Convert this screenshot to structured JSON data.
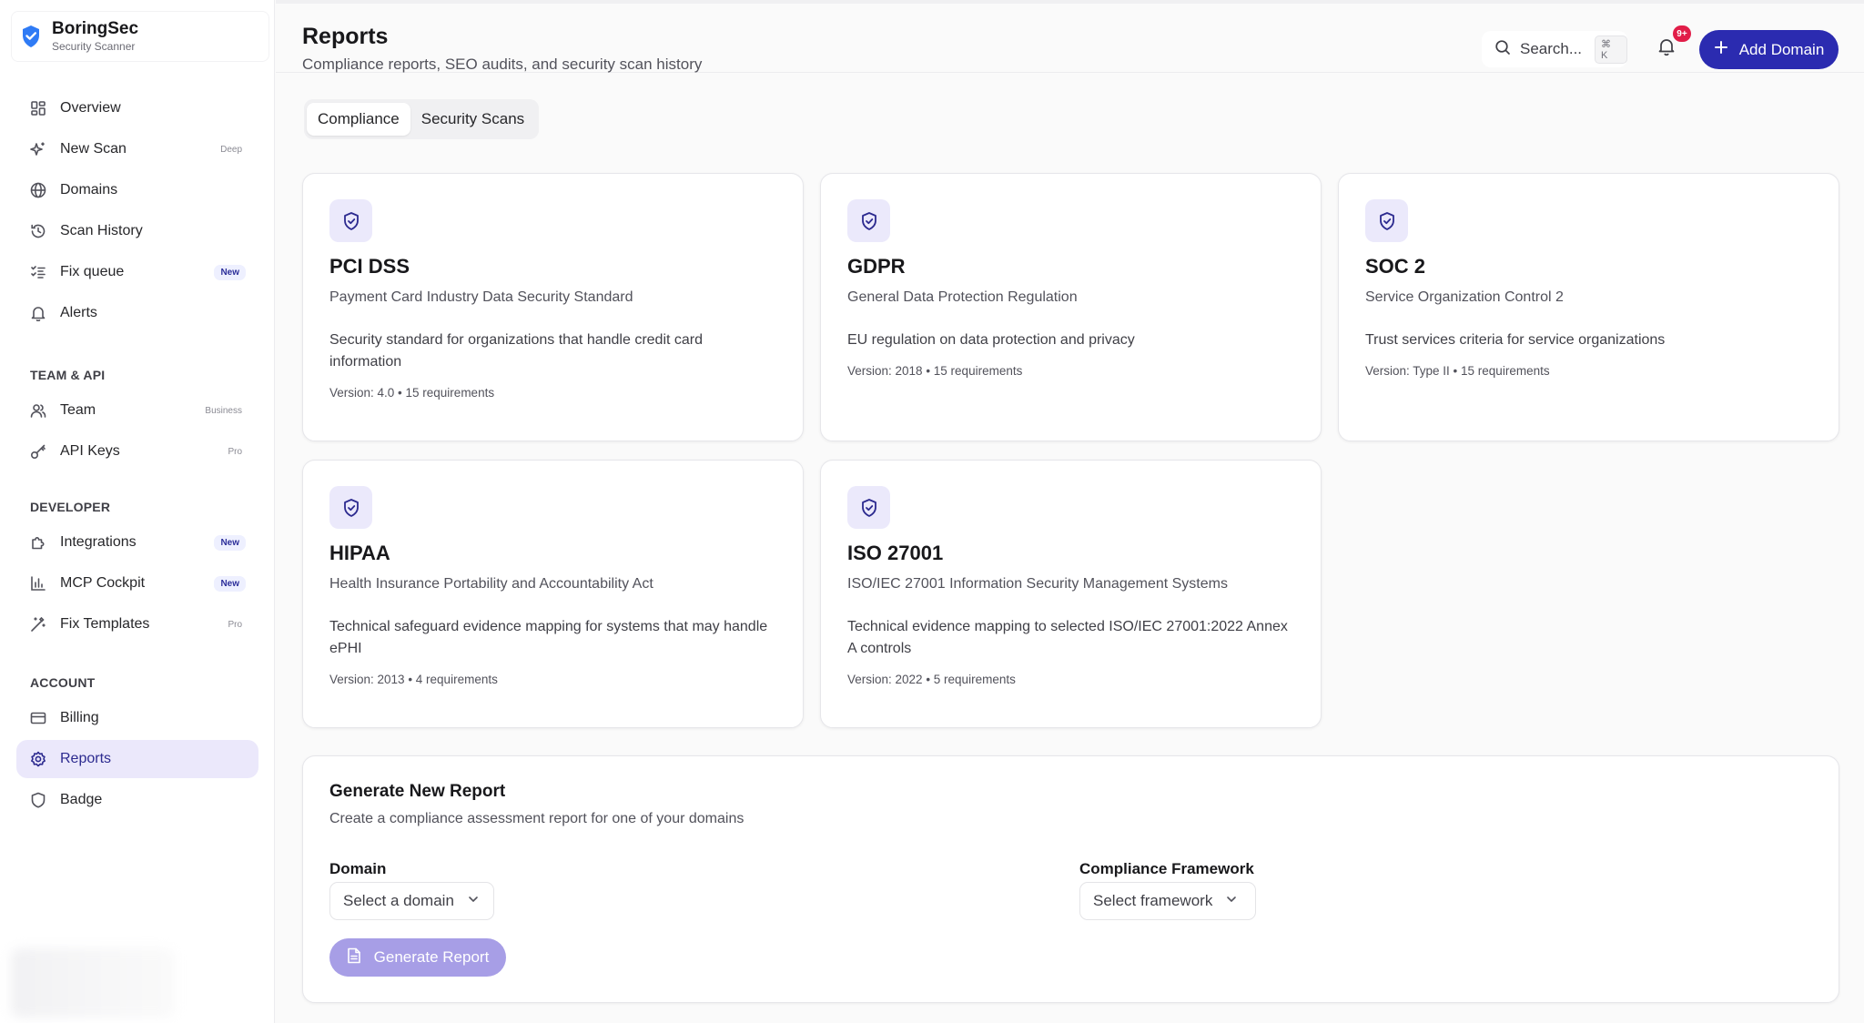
{
  "brand": {
    "name": "BoringSec",
    "subtitle": "Security Scanner",
    "logo_icon": "shield-check-icon",
    "accent": "#2b2bb0"
  },
  "sidebar": {
    "main": [
      {
        "label": "Overview",
        "icon": "grid-icon",
        "tag": ""
      },
      {
        "label": "New Scan",
        "icon": "sparkles-icon",
        "tag": "Deep"
      },
      {
        "label": "Domains",
        "icon": "globe-icon",
        "tag": ""
      },
      {
        "label": "Scan History",
        "icon": "history-icon",
        "tag": ""
      },
      {
        "label": "Fix queue",
        "icon": "list-checks-icon",
        "tag": "New"
      },
      {
        "label": "Alerts",
        "icon": "bell-icon",
        "tag": ""
      }
    ],
    "team_heading": "TEAM & API",
    "team": [
      {
        "label": "Team",
        "icon": "users-icon",
        "tag": "Business"
      },
      {
        "label": "API Keys",
        "icon": "key-icon",
        "tag": "Pro"
      }
    ],
    "developer_heading": "DEVELOPER",
    "developer": [
      {
        "label": "Integrations",
        "icon": "puzzle-icon",
        "tag": "New"
      },
      {
        "label": "MCP Cockpit",
        "icon": "bar-chart-icon",
        "tag": "New"
      },
      {
        "label": "Fix Templates",
        "icon": "wand-icon",
        "tag": "Pro"
      }
    ],
    "account_heading": "ACCOUNT",
    "account": [
      {
        "label": "Billing",
        "icon": "credit-card-icon",
        "tag": ""
      },
      {
        "label": "Reports",
        "icon": "gear-icon",
        "tag": "",
        "active": true
      },
      {
        "label": "Badge",
        "icon": "shield-icon",
        "tag": ""
      }
    ]
  },
  "header": {
    "title": "Reports",
    "subtitle": "Compliance reports, SEO audits, and security scan history",
    "search_placeholder": "Search...",
    "search_shortcut": "⌘ K",
    "notification_count": "9+",
    "add_domain_label": "Add Domain"
  },
  "tabs": [
    {
      "label": "Compliance",
      "active": true
    },
    {
      "label": "Security Scans",
      "active": false
    }
  ],
  "frameworks": [
    {
      "title": "PCI DSS",
      "full": "Payment Card Industry Data Security Standard",
      "description": "Security standard for organizations that handle credit card information",
      "meta": "Version: 4.0 • 15 requirements"
    },
    {
      "title": "GDPR",
      "full": "General Data Protection Regulation",
      "description": "EU regulation on data protection and privacy",
      "meta": "Version: 2018 • 15 requirements"
    },
    {
      "title": "SOC 2",
      "full": "Service Organization Control 2",
      "description": "Trust services criteria for service organizations",
      "meta": "Version: Type II • 15 requirements"
    },
    {
      "title": "HIPAA",
      "full": "Health Insurance Portability and Accountability Act",
      "description": "Technical safeguard evidence mapping for systems that may handle ePHI",
      "meta": "Version: 2013 • 4 requirements"
    },
    {
      "title": "ISO 27001",
      "full": "ISO/IEC 27001 Information Security Management Systems",
      "description": "Technical evidence mapping to selected ISO/IEC 27001:2022 Annex A controls",
      "meta": "Version: 2022 • 5 requirements"
    }
  ],
  "generate": {
    "title": "Generate New Report",
    "subtitle": "Create a compliance assessment report for one of your domains",
    "domain_label": "Domain",
    "domain_value": "Select a domain",
    "framework_label": "Compliance Framework",
    "framework_value": "Select framework",
    "button_label": "Generate Report"
  }
}
